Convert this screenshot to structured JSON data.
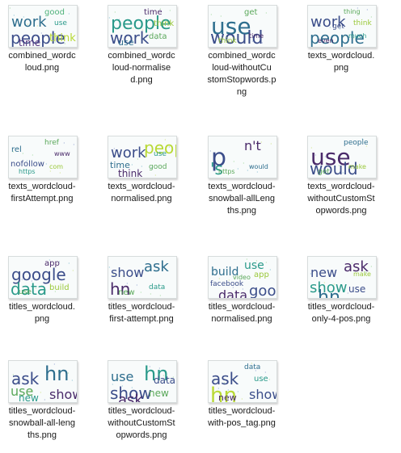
{
  "files": [
    {
      "name": "combined_wordcloud.png",
      "cap": [
        "combined_wordc",
        "loud.png"
      ],
      "words": [
        [
          "work",
          18,
          "#2e6e8e"
        ],
        [
          "people",
          20,
          "#3b4d8a"
        ],
        [
          "good",
          10,
          "#4fb27a"
        ],
        [
          "time",
          12,
          "#5a3a82"
        ],
        [
          "think",
          13,
          "#b8d934"
        ],
        [
          "use",
          9,
          "#2a9a8a"
        ]
      ]
    },
    {
      "name": "combined_wordcloud-normalised.png",
      "cap": [
        "combined_wordc",
        "loud-normalise",
        "d.png"
      ],
      "words": [
        [
          "people",
          22,
          "#2a9a8a"
        ],
        [
          "work",
          20,
          "#3b4d8a"
        ],
        [
          "time",
          10,
          "#4a2a6a"
        ],
        [
          "use",
          11,
          "#2e6e8e"
        ],
        [
          "data",
          10,
          "#5aa85a"
        ],
        [
          "think",
          10,
          "#9ac83a"
        ]
      ]
    },
    {
      "name": "combined_wordcloud-withoutCustomStopwords.png",
      "cap": [
        "combined_wordc",
        "loud-withoutCu",
        "stomStopwords.p",
        "ng"
      ],
      "words": [
        [
          "use",
          28,
          "#2e6e8e"
        ],
        [
          "would",
          22,
          "#3b4d8a"
        ],
        [
          "get",
          10,
          "#5aa85a"
        ],
        [
          "think",
          9,
          "#9ac83a"
        ],
        [
          "time",
          8,
          "#4a2a6a"
        ]
      ]
    },
    {
      "name": "texts_wordcloud.png",
      "cap": [
        "texts_wordcloud.",
        "png"
      ],
      "words": [
        [
          "work",
          18,
          "#3b4d8a"
        ],
        [
          "people",
          20,
          "#2e6e8e"
        ],
        [
          "thing",
          8,
          "#5aa85a"
        ],
        [
          "even",
          8,
          "#4a2a6a"
        ],
        [
          "much",
          8,
          "#2a9a8a"
        ],
        [
          "think",
          9,
          "#9ac83a"
        ],
        [
          "get",
          9,
          "#3b4d8a"
        ]
      ]
    },
    {
      "name": "texts_wordcloud-firstAttempt.png",
      "cap": [
        "texts_wordcloud-",
        "firstAttempt.png"
      ],
      "words": [
        [
          "rel",
          10,
          "#2e6e8e"
        ],
        [
          "nofollow",
          10,
          "#3b4d8a"
        ],
        [
          "href",
          9,
          "#5aa85a"
        ],
        [
          "https",
          8,
          "#2a9a8a"
        ],
        [
          "com",
          8,
          "#9ac83a"
        ],
        [
          "www",
          8,
          "#4a2a6a"
        ]
      ]
    },
    {
      "name": "texts_wordcloud-normalised.png",
      "cap": [
        "texts_wordcloud-",
        "normalised.png"
      ],
      "words": [
        [
          "work",
          18,
          "#3b4d8a"
        ],
        [
          "time",
          11,
          "#2e6e8e"
        ],
        [
          "people",
          20,
          "#b8d934"
        ],
        [
          "think",
          12,
          "#4a2a6a"
        ],
        [
          "good",
          9,
          "#5aa85a"
        ],
        [
          "use",
          9,
          "#2a9a8a"
        ]
      ]
    },
    {
      "name": "texts_wordcloud-snowball-allLengths.png",
      "cap": [
        "texts_wordcloud-",
        "snowball-allLeng",
        "ths.png"
      ],
      "words": [
        [
          "p",
          30,
          "#3b4d8a"
        ],
        [
          "'s",
          20,
          "#2a9a8a"
        ],
        [
          "n't",
          16,
          "#4a2a6a"
        ],
        [
          "https",
          8,
          "#5aa85a"
        ],
        [
          "would",
          8,
          "#2e6e8e"
        ]
      ]
    },
    {
      "name": "texts_wordcloud-withoutCustomStopwords.png",
      "cap": [
        "texts_wordcloud-",
        "withoutCustomSt",
        "opwords.png"
      ],
      "words": [
        [
          "use",
          28,
          "#4a2a6a"
        ],
        [
          "would",
          20,
          "#3b4d8a"
        ],
        [
          "people",
          9,
          "#2e6e8e"
        ],
        [
          "get",
          9,
          "#5aa85a"
        ],
        [
          "make",
          8,
          "#9ac83a"
        ]
      ]
    },
    {
      "name": "titles_wordcloud.png",
      "cap": [
        "titles_wordcloud.",
        "png"
      ],
      "words": [
        [
          "google",
          20,
          "#3b4d8a"
        ],
        [
          "data",
          20,
          "#2a9a8a"
        ],
        [
          "app",
          10,
          "#4a2a6a"
        ],
        [
          "use",
          9,
          "#5aa85a"
        ],
        [
          "build",
          10,
          "#9ac83a"
        ]
      ]
    },
    {
      "name": "titles_wordcloud-first-attempt.png",
      "cap": [
        "titles_wordcloud-",
        "first-attempt.png"
      ],
      "words": [
        [
          "show",
          16,
          "#3b4d8a"
        ],
        [
          "hn",
          20,
          "#4a2a6a"
        ],
        [
          "ask",
          18,
          "#2e6e8e"
        ],
        [
          "new",
          10,
          "#5aa85a"
        ],
        [
          "data",
          9,
          "#2a9a8a"
        ]
      ]
    },
    {
      "name": "titles_wordcloud-normalised.png",
      "cap": [
        "titles_wordcloud-",
        "normalised.png"
      ],
      "words": [
        [
          "build",
          14,
          "#2e6e8e"
        ],
        [
          "facebook",
          9,
          "#3b4d8a"
        ],
        [
          "use",
          14,
          "#2a9a8a"
        ],
        [
          "data",
          16,
          "#4a2a6a"
        ],
        [
          "google",
          18,
          "#3b4d8a"
        ],
        [
          "app",
          10,
          "#9ac83a"
        ],
        [
          "video",
          8,
          "#5aa85a"
        ]
      ]
    },
    {
      "name": "titles_wordcloud-only-4-pos.png",
      "cap": [
        "titles_wordcloud-",
        "only-4-pos.png"
      ],
      "words": [
        [
          "new",
          16,
          "#3b4d8a"
        ],
        [
          "show",
          18,
          "#2a9a8a"
        ],
        [
          "ask",
          18,
          "#4a2a6a"
        ],
        [
          "hn",
          22,
          "#2e6e8e"
        ],
        [
          "use",
          12,
          "#3b4d8a"
        ],
        [
          "make",
          8,
          "#9ac83a"
        ]
      ]
    },
    {
      "name": "titles_wordcloud-snowball-all-lengths.png",
      "cap": [
        "titles_wordcloud-",
        "snowball-all-leng",
        "ths.png"
      ],
      "words": [
        [
          "ask",
          20,
          "#3b4d8a"
        ],
        [
          "use",
          16,
          "#5aa85a"
        ],
        [
          "hn",
          24,
          "#2e6e8e"
        ],
        [
          "new",
          12,
          "#2a9a8a"
        ],
        [
          "show",
          16,
          "#4a2a6a"
        ]
      ]
    },
    {
      "name": "titles_wordcloud-withoutCustomStopwords.png",
      "cap": [
        "titles_wordcloud-",
        "withoutCustomSt",
        "opwords.png"
      ],
      "words": [
        [
          "use",
          16,
          "#2e6e8e"
        ],
        [
          "show",
          20,
          "#3b4d8a"
        ],
        [
          "hn",
          24,
          "#2a9a8a"
        ],
        [
          "ask",
          18,
          "#4a2a6a"
        ],
        [
          "new",
          12,
          "#5aa85a"
        ],
        [
          "data",
          12,
          "#3b4d8a"
        ]
      ]
    },
    {
      "name": "titles_wordcloud-with-pos_tag.png",
      "cap": [
        "titles_wordcloud-",
        "with-pos_tag.png"
      ],
      "words": [
        [
          "ask",
          20,
          "#3b4d8a"
        ],
        [
          "hn",
          26,
          "#b8d934"
        ],
        [
          "data",
          9,
          "#2e6e8e"
        ],
        [
          "new",
          11,
          "#4a2a6a"
        ],
        [
          "show",
          16,
          "#3b4d8a"
        ],
        [
          "use",
          10,
          "#2a9a8a"
        ]
      ]
    }
  ]
}
